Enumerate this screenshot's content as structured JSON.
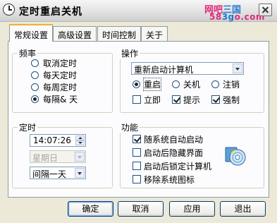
{
  "window": {
    "title": "定时重启关机"
  },
  "watermark": {
    "line1_pink": "网吧",
    "line1_blue": "三国",
    "line2_a": "58",
    "line2_b": "3g",
    "line2_c": "o.com"
  },
  "tabs": [
    {
      "label": "常规设置",
      "active": true
    },
    {
      "label": "高级设置",
      "active": false
    },
    {
      "label": "时间控制",
      "active": false
    },
    {
      "label": "关于",
      "active": false
    }
  ],
  "frequency": {
    "label": "频率",
    "options": [
      {
        "label": "取消定时",
        "selected": false
      },
      {
        "label": "每天定时",
        "selected": false
      },
      {
        "label": "每周定时",
        "selected": false
      },
      {
        "label": "每隔& 天",
        "selected": true
      }
    ]
  },
  "operation": {
    "label": "操作",
    "action_select": "重新启动计算机",
    "radios": [
      {
        "label": "重启",
        "selected": true
      },
      {
        "label": "关机",
        "selected": false
      },
      {
        "label": "注销",
        "selected": false
      }
    ],
    "checks": [
      {
        "label": "立即",
        "checked": false
      },
      {
        "label": "提示",
        "checked": true
      },
      {
        "label": "强制",
        "checked": true
      }
    ]
  },
  "timing": {
    "label": "定时",
    "time_value": "14:07:26",
    "weekday_select": "星期日",
    "interval_select": "间隔一天"
  },
  "features": {
    "label": "功能",
    "items": [
      {
        "label": "随系统自动启动",
        "checked": true
      },
      {
        "label": "启动后隐藏界面",
        "checked": false
      },
      {
        "label": "启动后锁定计算机",
        "checked": false
      },
      {
        "label": "移除系统图标",
        "checked": false
      }
    ],
    "icon": "cd-disc-icon"
  },
  "buttons": {
    "ok": "确定",
    "cancel": "取消",
    "apply": "应用",
    "exit": "退出"
  }
}
